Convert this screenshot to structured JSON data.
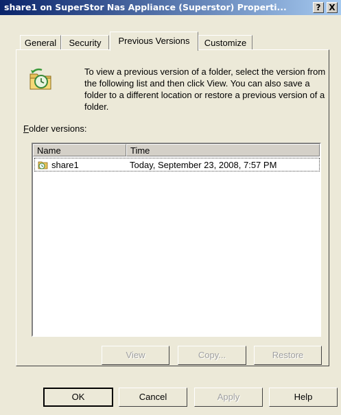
{
  "window": {
    "title": "share1 on SuperStor Nas Appliance (Superstor) Properti...",
    "help_btn": "?",
    "close_btn": "X"
  },
  "tabs": [
    {
      "label": "General",
      "active": false
    },
    {
      "label": "Security",
      "active": false
    },
    {
      "label": "Previous Versions",
      "active": true
    },
    {
      "label": "Customize",
      "active": false
    }
  ],
  "intro_text": "To view a previous version of a folder, select the version from the following list and then click View.  You can also save a folder to a different location or restore a previous version of a folder.",
  "folder_versions_label": "Folder versions:",
  "list": {
    "columns": [
      "Name",
      "Time"
    ],
    "rows": [
      {
        "icon": "folder-clock-icon",
        "name": "share1",
        "time": "Today, September 23, 2008, 7:57 PM"
      }
    ]
  },
  "actions": {
    "view": "View",
    "copy": "Copy...",
    "restore": "Restore"
  },
  "footer": {
    "ok": "OK",
    "cancel": "Cancel",
    "apply": "Apply",
    "help": "Help"
  }
}
